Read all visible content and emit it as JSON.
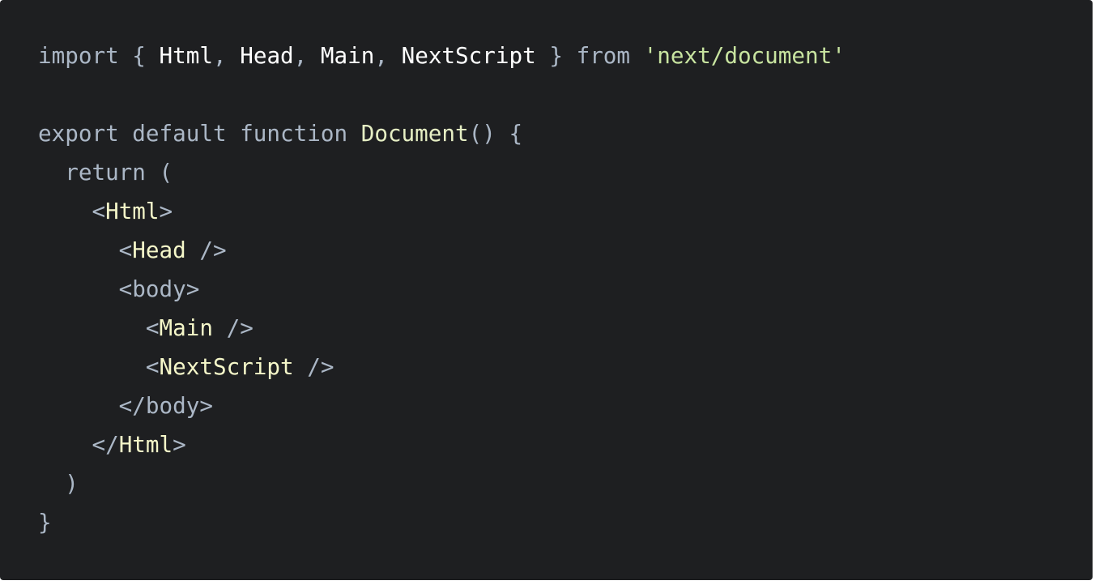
{
  "colors": {
    "background": "#1e1f21",
    "keyword": "#abb7c6",
    "identifier": "#ffffff",
    "string": "#c8e4a0",
    "function": "#e6efc4",
    "tag": "#f5f7c9"
  },
  "code": {
    "lines": [
      {
        "tokens": [
          {
            "type": "keyword",
            "text": "import"
          },
          {
            "type": "punct",
            "text": " { "
          },
          {
            "type": "ident",
            "text": "Html"
          },
          {
            "type": "punct",
            "text": ", "
          },
          {
            "type": "ident",
            "text": "Head"
          },
          {
            "type": "punct",
            "text": ", "
          },
          {
            "type": "ident",
            "text": "Main"
          },
          {
            "type": "punct",
            "text": ", "
          },
          {
            "type": "ident",
            "text": "NextScript"
          },
          {
            "type": "punct",
            "text": " } "
          },
          {
            "type": "keyword",
            "text": "from"
          },
          {
            "type": "punct",
            "text": " "
          },
          {
            "type": "string",
            "text": "'next/document'"
          }
        ]
      },
      {
        "tokens": []
      },
      {
        "tokens": [
          {
            "type": "keyword",
            "text": "export default function "
          },
          {
            "type": "func",
            "text": "Document"
          },
          {
            "type": "punct",
            "text": "() {"
          }
        ]
      },
      {
        "tokens": [
          {
            "type": "keyword",
            "text": "  return"
          },
          {
            "type": "punct",
            "text": " ("
          }
        ]
      },
      {
        "tokens": [
          {
            "type": "punct",
            "text": "    <"
          },
          {
            "type": "tag",
            "text": "Html"
          },
          {
            "type": "punct",
            "text": ">"
          }
        ]
      },
      {
        "tokens": [
          {
            "type": "punct",
            "text": "      <"
          },
          {
            "type": "tag",
            "text": "Head"
          },
          {
            "type": "punct",
            "text": " />"
          }
        ]
      },
      {
        "tokens": [
          {
            "type": "punct",
            "text": "      <body>"
          }
        ]
      },
      {
        "tokens": [
          {
            "type": "punct",
            "text": "        <"
          },
          {
            "type": "tag",
            "text": "Main"
          },
          {
            "type": "punct",
            "text": " />"
          }
        ]
      },
      {
        "tokens": [
          {
            "type": "punct",
            "text": "        <"
          },
          {
            "type": "tag",
            "text": "NextScript"
          },
          {
            "type": "punct",
            "text": " />"
          }
        ]
      },
      {
        "tokens": [
          {
            "type": "punct",
            "text": "      </body>"
          }
        ]
      },
      {
        "tokens": [
          {
            "type": "punct",
            "text": "    </"
          },
          {
            "type": "tag",
            "text": "Html"
          },
          {
            "type": "punct",
            "text": ">"
          }
        ]
      },
      {
        "tokens": [
          {
            "type": "punct",
            "text": "  )"
          }
        ]
      },
      {
        "tokens": [
          {
            "type": "punct",
            "text": "}"
          }
        ]
      }
    ]
  }
}
